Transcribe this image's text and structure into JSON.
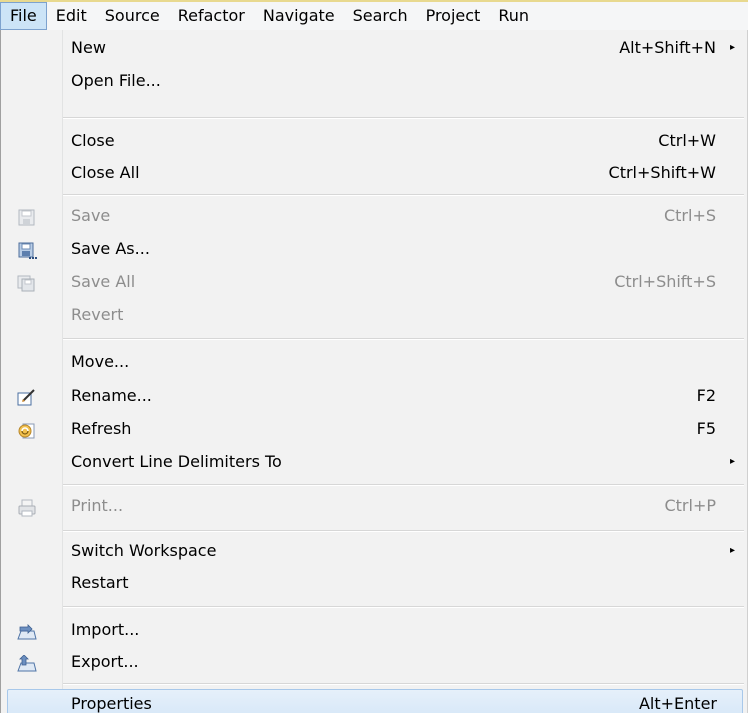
{
  "menubar": {
    "items": [
      {
        "label": "File"
      },
      {
        "label": "Edit"
      },
      {
        "label": "Source"
      },
      {
        "label": "Refactor"
      },
      {
        "label": "Navigate"
      },
      {
        "label": "Search"
      },
      {
        "label": "Project"
      },
      {
        "label": "Run"
      }
    ]
  },
  "file_menu": {
    "new": {
      "label": "New",
      "shortcut": "Alt+Shift+N",
      "submenu_arrow": "▸"
    },
    "open_file": {
      "label": "Open File..."
    },
    "close": {
      "label": "Close",
      "shortcut": "Ctrl+W"
    },
    "close_all": {
      "label": "Close All",
      "shortcut": "Ctrl+Shift+W"
    },
    "save": {
      "label": "Save",
      "shortcut": "Ctrl+S",
      "icon": "save-icon",
      "enabled": false
    },
    "save_as": {
      "label": "Save As...",
      "icon": "save-as-icon"
    },
    "save_all": {
      "label": "Save All",
      "shortcut": "Ctrl+Shift+S",
      "icon": "save-all-icon",
      "enabled": false
    },
    "revert": {
      "label": "Revert",
      "enabled": false
    },
    "move": {
      "label": "Move..."
    },
    "rename": {
      "label": "Rename...",
      "shortcut": "F2",
      "icon": "rename-icon"
    },
    "refresh": {
      "label": "Refresh",
      "shortcut": "F5",
      "icon": "refresh-icon"
    },
    "convert_line_delimiters": {
      "label": "Convert Line Delimiters To",
      "submenu_arrow": "▸"
    },
    "print": {
      "label": "Print...",
      "shortcut": "Ctrl+P",
      "icon": "print-icon",
      "enabled": false
    },
    "switch_workspace": {
      "label": "Switch Workspace",
      "submenu_arrow": "▸"
    },
    "restart": {
      "label": "Restart"
    },
    "import": {
      "label": "Import...",
      "icon": "import-icon"
    },
    "export": {
      "label": "Export...",
      "icon": "export-icon"
    },
    "properties": {
      "label": "Properties",
      "shortcut": "Alt+Enter",
      "highlighted": true
    }
  }
}
